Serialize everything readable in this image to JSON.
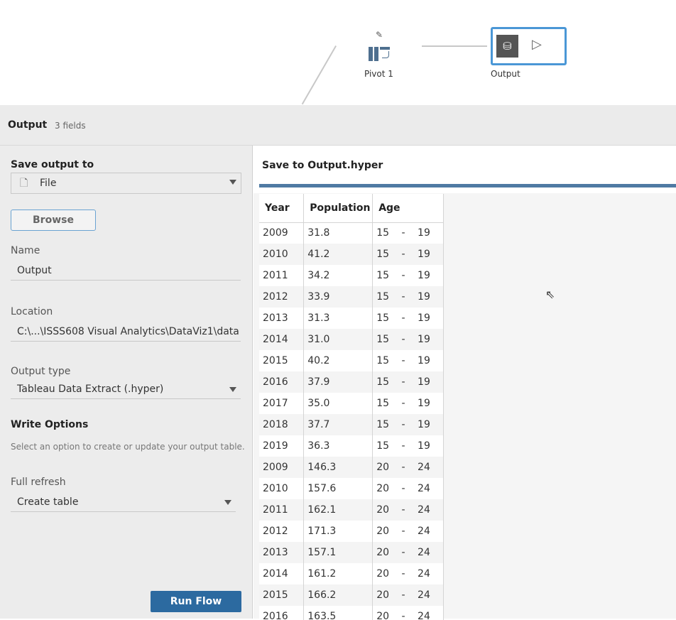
{
  "flow": {
    "nodes": [
      {
        "label": "Pivot 1"
      },
      {
        "label": "Output"
      }
    ]
  },
  "header": {
    "title": "Output",
    "fields": "3 fields"
  },
  "left": {
    "save_output_to_label": "Save output to",
    "save_output_to_value": "File",
    "browse_label": "Browse",
    "name_label": "Name",
    "name_value": "Output",
    "location_label": "Location",
    "location_value": "C:\\...\\ISSS608 Visual Analytics\\DataViz1\\data",
    "output_type_label": "Output type",
    "output_type_value": "Tableau Data Extract (.hyper)",
    "write_options_label": "Write Options",
    "write_options_hint": "Select an option to create or update your output table.",
    "refresh_label": "Full refresh",
    "refresh_value": "Create table",
    "run_flow_label": "Run Flow"
  },
  "preview": {
    "title": "Save to Output.hyper",
    "accent": "#4f7aa3",
    "columns": [
      "Year",
      "Population",
      "Age"
    ],
    "rows": [
      [
        "2009",
        "31.8",
        "15",
        "19"
      ],
      [
        "2010",
        "41.2",
        "15",
        "19"
      ],
      [
        "2011",
        "34.2",
        "15",
        "19"
      ],
      [
        "2012",
        "33.9",
        "15",
        "19"
      ],
      [
        "2013",
        "31.3",
        "15",
        "19"
      ],
      [
        "2014",
        "31.0",
        "15",
        "19"
      ],
      [
        "2015",
        "40.2",
        "15",
        "19"
      ],
      [
        "2016",
        "37.9",
        "15",
        "19"
      ],
      [
        "2017",
        "35.0",
        "15",
        "19"
      ],
      [
        "2018",
        "37.7",
        "15",
        "19"
      ],
      [
        "2019",
        "36.3",
        "15",
        "19"
      ],
      [
        "2009",
        "146.3",
        "20",
        "24"
      ],
      [
        "2010",
        "157.6",
        "20",
        "24"
      ],
      [
        "2011",
        "162.1",
        "20",
        "24"
      ],
      [
        "2012",
        "171.3",
        "20",
        "24"
      ],
      [
        "2013",
        "157.1",
        "20",
        "24"
      ],
      [
        "2014",
        "161.2",
        "20",
        "24"
      ],
      [
        "2015",
        "166.2",
        "20",
        "24"
      ],
      [
        "2016",
        "163.5",
        "20",
        "24"
      ]
    ]
  }
}
